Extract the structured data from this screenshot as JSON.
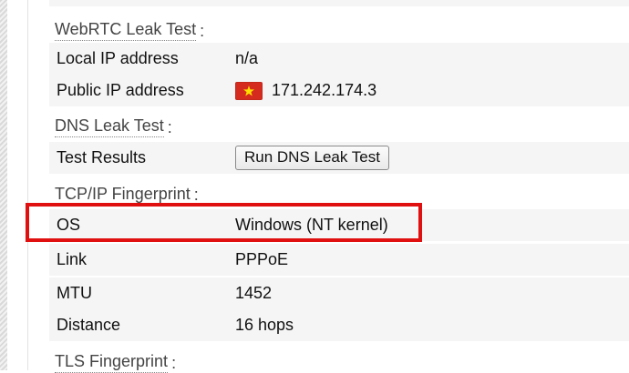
{
  "colors": {
    "accent_highlight": "#e01010",
    "row_shade": "#f5f5f5",
    "flag_red": "#d52b1e",
    "flag_star": "#ffde00"
  },
  "webrtc": {
    "title": "WebRTC Leak Test",
    "colon": ":",
    "rows": [
      {
        "label": "Local IP address",
        "value": "n/a"
      },
      {
        "label": "Public IP address",
        "value": "171.242.174.3",
        "icon": "vietnam-flag-icon"
      }
    ]
  },
  "dns": {
    "title": "DNS Leak Test",
    "colon": ":",
    "rows": [
      {
        "label": "Test Results",
        "button_label": "Run DNS Leak Test"
      }
    ]
  },
  "tcpip": {
    "title": "TCP/IP Fingerprint",
    "colon": ":",
    "rows": [
      {
        "label": "OS",
        "value": "Windows (NT kernel)"
      },
      {
        "label": "Link",
        "value": "PPPoE"
      },
      {
        "label": "MTU",
        "value": "1452"
      },
      {
        "label": "Distance",
        "value": "16 hops"
      }
    ]
  },
  "tls": {
    "title": "TLS Fingerprint",
    "colon": ":"
  }
}
